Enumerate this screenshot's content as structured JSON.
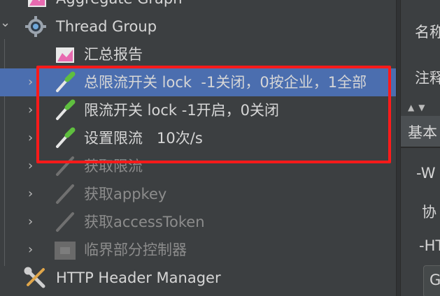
{
  "tree": {
    "rows": [
      {
        "label": "Aggregate Graph",
        "icon": "aggregate-graph-icon"
      },
      {
        "label": "Thread Group",
        "icon": "gear-icon",
        "arrow": "⌄"
      },
      {
        "label": "汇总报告",
        "icon": "aggregate-graph-icon"
      },
      {
        "label": "总限流开关 lock  -1关闭，0按企业，1全部",
        "icon": "pipette-icon",
        "arrow": "›"
      },
      {
        "label": "限流开关 lock -1开启，0关闭",
        "icon": "pipette-icon",
        "arrow": "›"
      },
      {
        "label": "设置限流   10次/s",
        "icon": "pipette-icon",
        "arrow": "›"
      },
      {
        "label": "获取限流",
        "icon": "pipette-disabled-icon",
        "arrow": "›"
      },
      {
        "label": "获取appkey",
        "icon": "pipette-disabled-icon",
        "arrow": "›"
      },
      {
        "label": "获取accessToken",
        "icon": "pipette-disabled-icon",
        "arrow": "›"
      },
      {
        "label": "临界部分控制器",
        "icon": "controller-disabled-icon",
        "arrow": "›"
      },
      {
        "label": "HTTP Header Manager",
        "icon": "wrench-icon"
      }
    ]
  },
  "right_panel": {
    "name_label": "名称",
    "comment_label": "注释",
    "tab_label": "基本",
    "section_web": "-W",
    "protocol_label": "协",
    "section_ht": "-HT",
    "input_value": "G"
  },
  "colors": {
    "background": "#3c3f41",
    "selection": "#4b6eaf",
    "highlight_box": "#ff1a1a"
  }
}
